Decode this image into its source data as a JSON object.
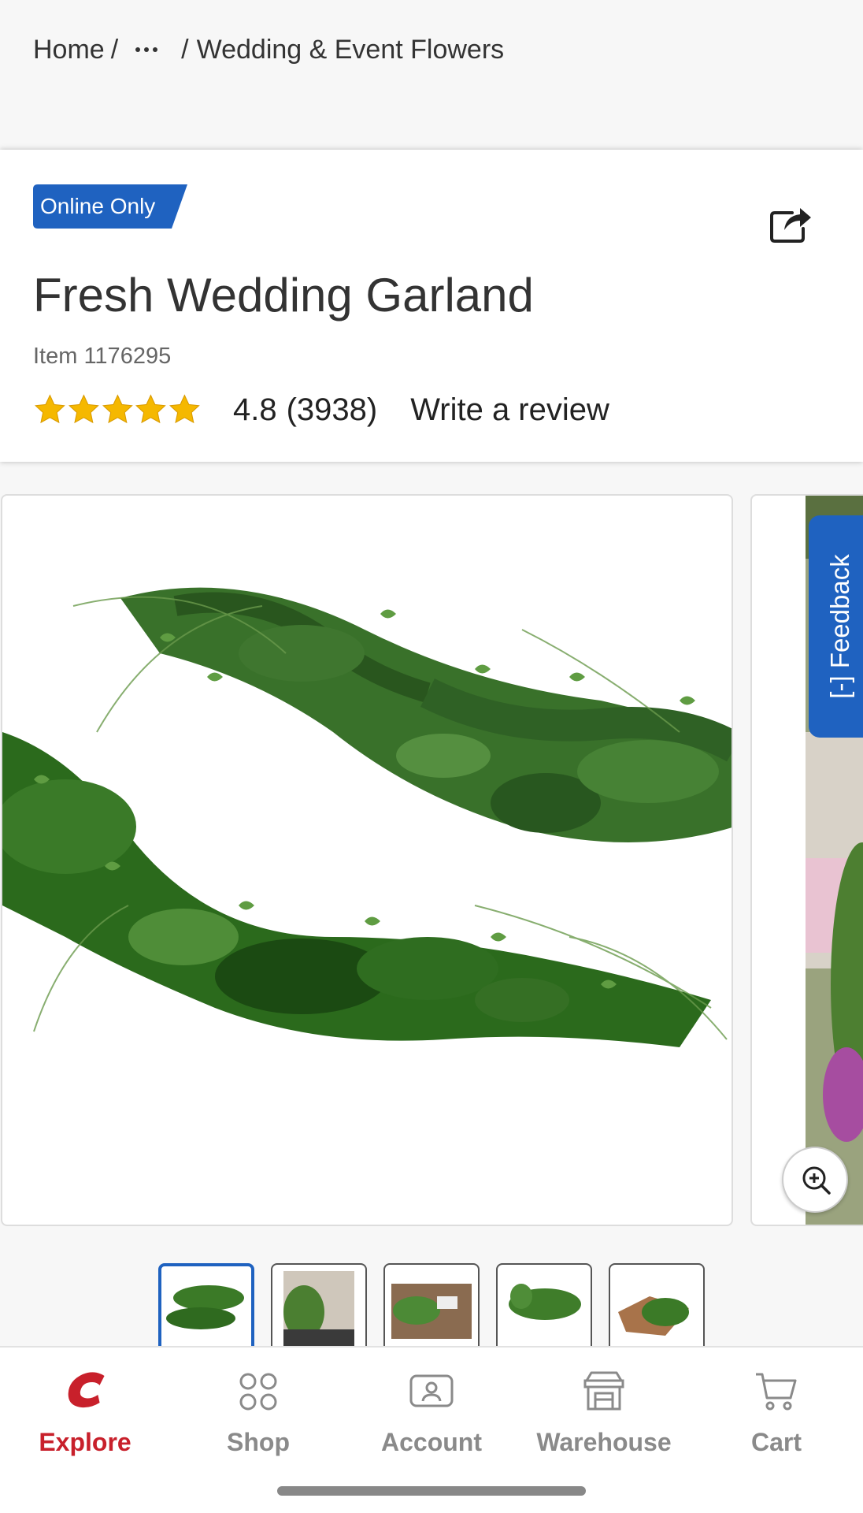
{
  "breadcrumb": {
    "home": "Home",
    "more_icon": "ellipsis-icon",
    "current": "Wedding & Event Flowers"
  },
  "product": {
    "badge": "Online Only",
    "title": "Fresh Wedding Garland",
    "item_number": "Item 1176295",
    "rating": {
      "stars_shown": 5,
      "value": "4.8",
      "count": "(3938)"
    },
    "write_review": "Write a review"
  },
  "gallery": {
    "feedback_label": "Feedback",
    "feedback_prefix": "[-]",
    "thumbnail_count": 5,
    "selected_thumbnail": 1
  },
  "nav": [
    {
      "label": "Explore",
      "icon": "costco-c-icon",
      "active": true
    },
    {
      "label": "Shop",
      "icon": "grid-icon",
      "active": false
    },
    {
      "label": "Account",
      "icon": "account-icon",
      "active": false
    },
    {
      "label": "Warehouse",
      "icon": "warehouse-icon",
      "active": false
    },
    {
      "label": "Cart",
      "icon": "cart-icon",
      "active": false
    }
  ],
  "colors": {
    "accent_blue": "#1f62c0",
    "brand_red": "#c8202b",
    "star": "#f5b800"
  }
}
